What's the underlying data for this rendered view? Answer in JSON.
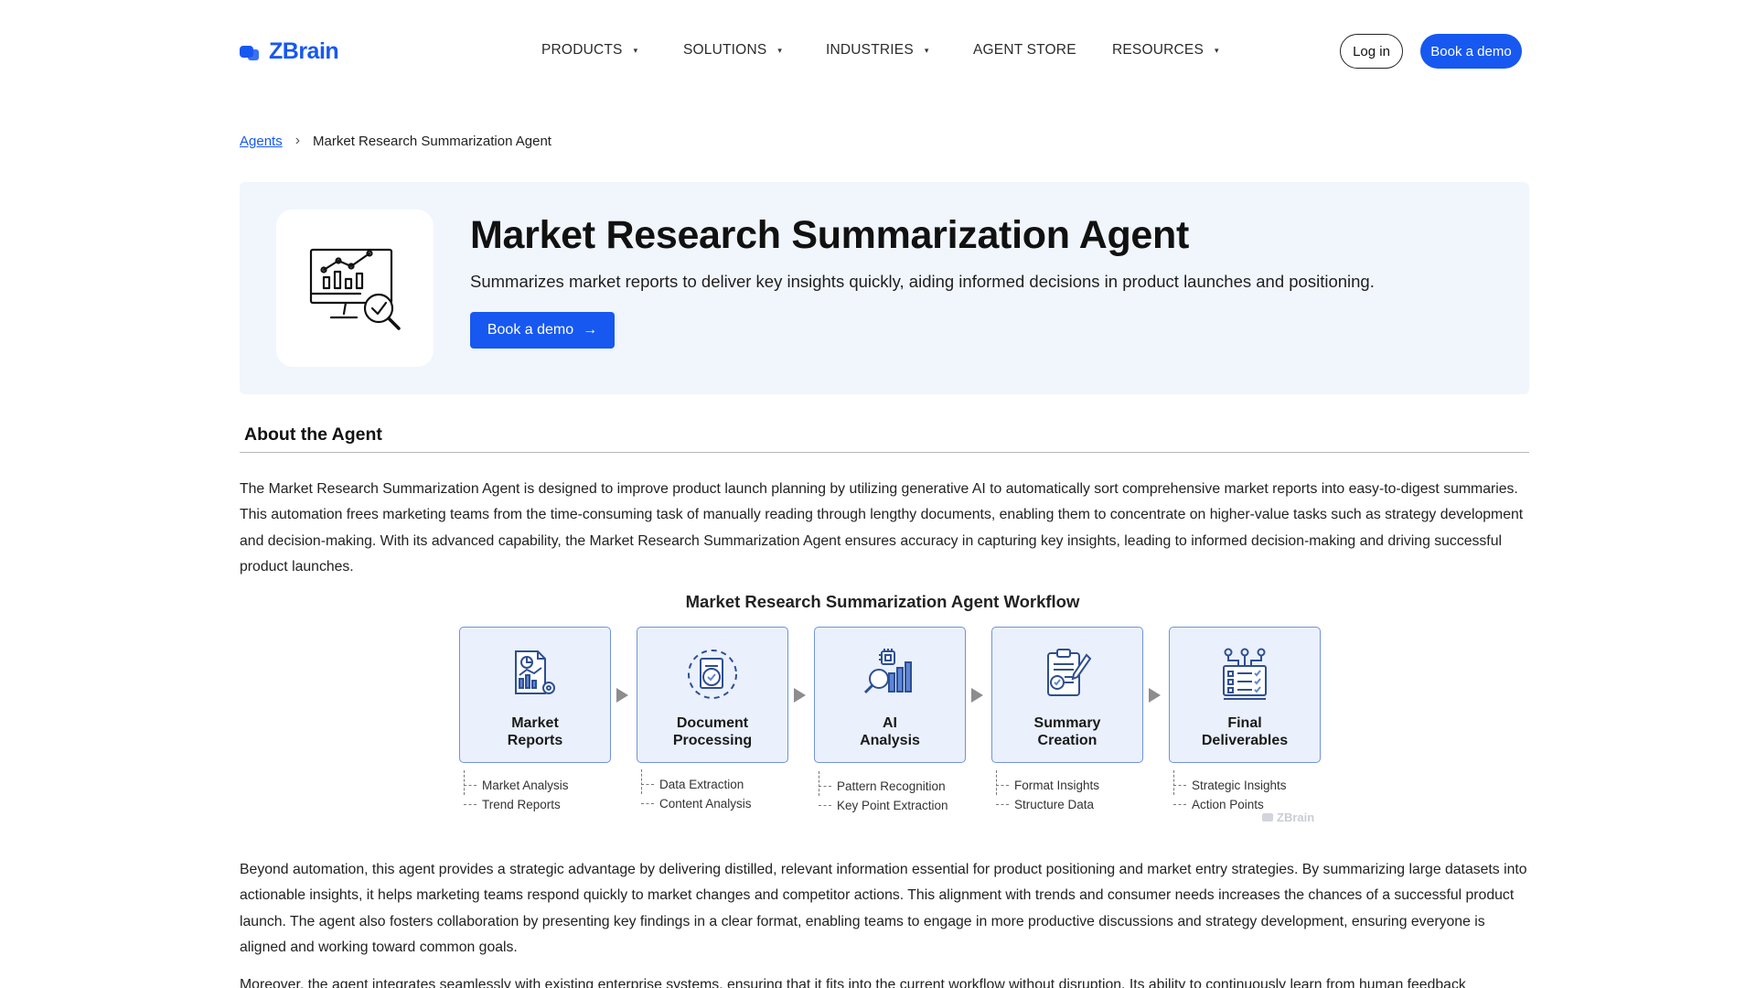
{
  "brand": {
    "name": "ZBrain",
    "accent": "#1758f0"
  },
  "nav": {
    "items": [
      {
        "label": "PRODUCTS",
        "caret": "▾"
      },
      {
        "label": "SOLUTIONS",
        "caret": "▾"
      },
      {
        "label": "INDUSTRIES",
        "caret": "▾"
      },
      {
        "label": "AGENT STORE",
        "caret": ""
      },
      {
        "label": "RESOURCES",
        "caret": "▾"
      }
    ],
    "login_label": "Log in",
    "demo_label": "Book a demo"
  },
  "breadcrumb": {
    "root": "Agents",
    "separator": "›",
    "current": "Market Research Summarization Agent"
  },
  "hero": {
    "icon": "analytics-monitor-check-icon",
    "title": "Market Research Summarization Agent",
    "description": "Summarizes market reports to deliver key insights quickly, aiding informed decisions in product launches and positioning.",
    "button_label": "Book a demo",
    "button_arrow": "→",
    "background": "#f1f5fc"
  },
  "about": {
    "heading": "About the Agent",
    "paragraph_1": "The Market Research Summarization Agent is designed to improve product launch planning by utilizing generative AI to automatically sort comprehensive market reports into easy-to-digest summaries. This automation frees marketing teams from the time-consuming task of manually reading through lengthy documents, enabling them to concentrate on higher-value tasks such as strategy development and decision-making. With its advanced capability, the Market Research Summarization Agent ensures accuracy in capturing key insights, leading to informed decision-making and driving successful product launches.",
    "paragraph_2": "Beyond automation, this agent provides a strategic advantage by delivering distilled, relevant information essential for product positioning and market entry strategies. By summarizing large datasets into actionable insights, it helps marketing teams respond quickly to market changes and competitor actions. This alignment with trends and consumer needs increases the chances of a successful product launch. The agent also fosters collaboration by presenting key findings in a clear format, enabling teams to engage in more productive discussions and strategy development, ensuring everyone is aligned and working toward common goals.",
    "paragraph_3": "Moreover, the agent integrates seamlessly with existing enterprise systems, ensuring that it fits into the current workflow without disruption. Its ability to continuously learn from human feedback"
  },
  "workflow": {
    "title": "Market Research Summarization Agent Workflow",
    "watermark": "ZBrain",
    "box_fill": "#eaf0fc",
    "box_border": "#6f93db",
    "steps": [
      {
        "line1": "Market",
        "line2": "Reports",
        "icon": "report-chart-icon",
        "subs": [
          "Market Analysis",
          "Trend Reports"
        ]
      },
      {
        "line1": "Document",
        "line2": "Processing",
        "icon": "document-cycle-icon",
        "subs": [
          "Data Extraction",
          "Content Analysis"
        ]
      },
      {
        "line1": "AI",
        "line2": "Analysis",
        "icon": "ai-magnifier-icon",
        "subs": [
          "Pattern Recognition",
          "Key Point Extraction"
        ]
      },
      {
        "line1": "Summary",
        "line2": "Creation",
        "icon": "clipboard-pen-icon",
        "subs": [
          "Format Insights",
          "Structure Data"
        ]
      },
      {
        "line1": "Final",
        "line2": "Deliverables",
        "icon": "checklist-monitor-icon",
        "subs": [
          "Strategic Insights",
          "Action Points"
        ]
      }
    ]
  }
}
